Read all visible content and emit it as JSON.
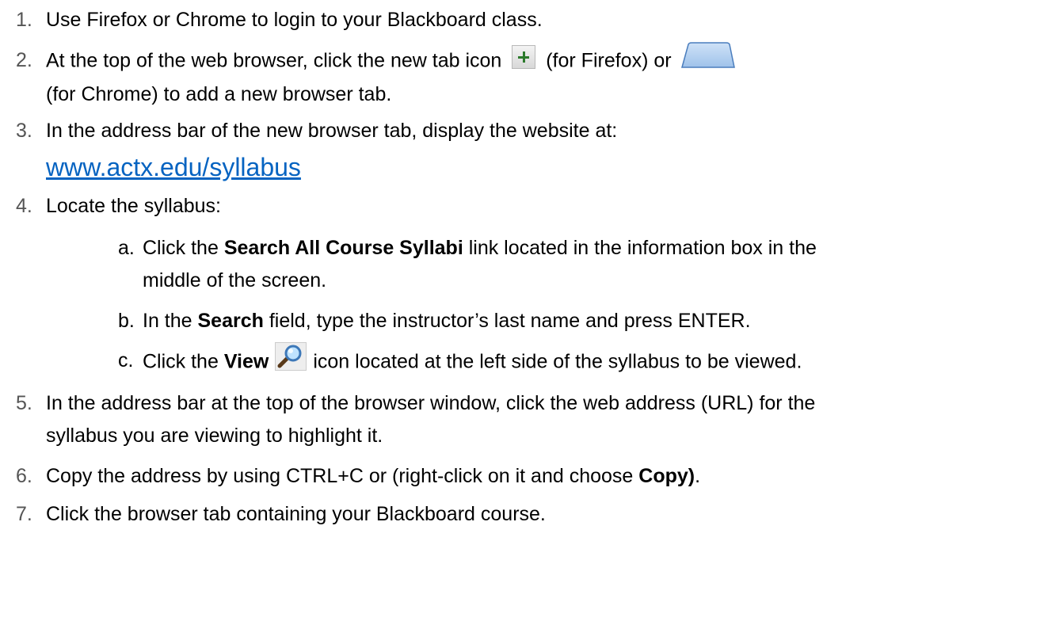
{
  "steps": [
    {
      "num": "1.",
      "text": "Use Firefox or Chrome to login to your Blackboard class."
    },
    {
      "num": "2.",
      "line1_pre": "At the top of the web browser, click the new tab icon",
      "line1_mid": "(for Firefox) or",
      "line2": "(for Chrome) to add a new browser tab."
    },
    {
      "num": "3.",
      "text": "In the address bar of the new browser tab, display the website at:",
      "link": "www.actx.edu/syllabus"
    },
    {
      "num": "4.",
      "text": "Locate the syllabus:",
      "sub": [
        {
          "letter": "a.",
          "pre": "Click the ",
          "bold": "Search All Course Syllabi",
          "post": " link located in the information box in the",
          "line2": "middle of the screen."
        },
        {
          "letter": "b.",
          "pre": "In the ",
          "bold": "Search",
          "post": " field, type the instructor’s last name and press ENTER."
        },
        {
          "letter": "c.",
          "pre": "Click the ",
          "bold": "View",
          "post": "icon located at the left side of the syllabus to be viewed."
        }
      ]
    },
    {
      "num": "5.",
      "line1": "In the address bar at the top of the browser window, click the web address (URL) for the",
      "line2": "syllabus you are viewing to highlight it."
    },
    {
      "num": "6.",
      "pre": "Copy the address by using CTRL+C or (right-click on it and choose ",
      "bold": "Copy)",
      "post": "."
    },
    {
      "num": "7.",
      "text": "Click the browser tab containing your Blackboard course."
    }
  ],
  "colors": {
    "link": "#0563c1",
    "number": "#555555"
  },
  "icons": {
    "firefox_new_tab": "plus-icon",
    "chrome_new_tab": "chrome-tab-icon",
    "view": "magnifier-icon"
  }
}
